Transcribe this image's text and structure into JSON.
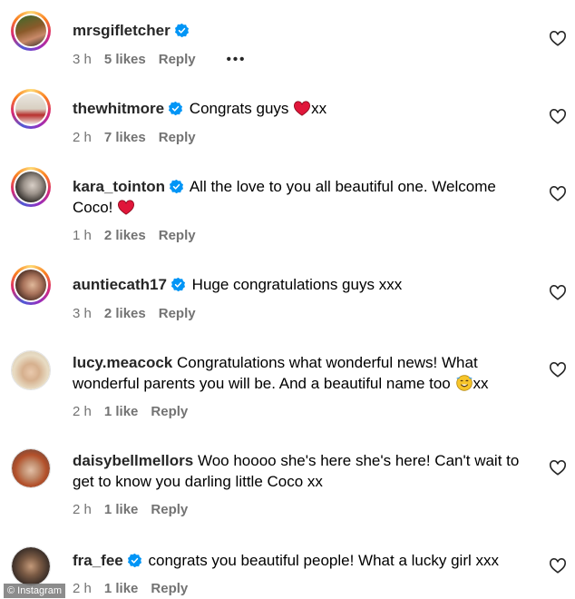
{
  "comments": [
    {
      "username": "mrsgifletcher",
      "text": "",
      "time": "3 h",
      "likes": "5 likes",
      "reply": "Reply",
      "more": "•••"
    },
    {
      "username": "thewhitmore",
      "text": "Congrats guys",
      "suffix": "xx",
      "time": "2 h",
      "likes": "7 likes",
      "reply": "Reply"
    },
    {
      "username": "kara_tointon",
      "text": "All the love to you all beautiful one. Welcome Coco!",
      "time": "1 h",
      "likes": "2 likes",
      "reply": "Reply"
    },
    {
      "username": "auntiecath17",
      "text": "Huge congratulations guys xxx",
      "time": "3 h",
      "likes": "2 likes",
      "reply": "Reply"
    },
    {
      "username": "lucy.meacock",
      "text": "Congratulations what wonderful news! What wonderful parents you will be. And a beautiful name too",
      "suffix": "xx",
      "time": "2 h",
      "likes": "1 like",
      "reply": "Reply"
    },
    {
      "username": "daisybellmellors",
      "text": "Woo hoooo she's here she's here! Can't wait to get to know you darling little Coco xx",
      "time": "2 h",
      "likes": "1 like",
      "reply": "Reply"
    },
    {
      "username": "fra_fee",
      "text": "congrats you beautiful people! What a lucky girl xxx",
      "time": "2 h",
      "likes": "1 like",
      "reply": "Reply"
    }
  ],
  "watermark": "© Instagram",
  "colors": {
    "verified": "#0095f6",
    "heart": "#ed4956",
    "meta": "#737373"
  }
}
